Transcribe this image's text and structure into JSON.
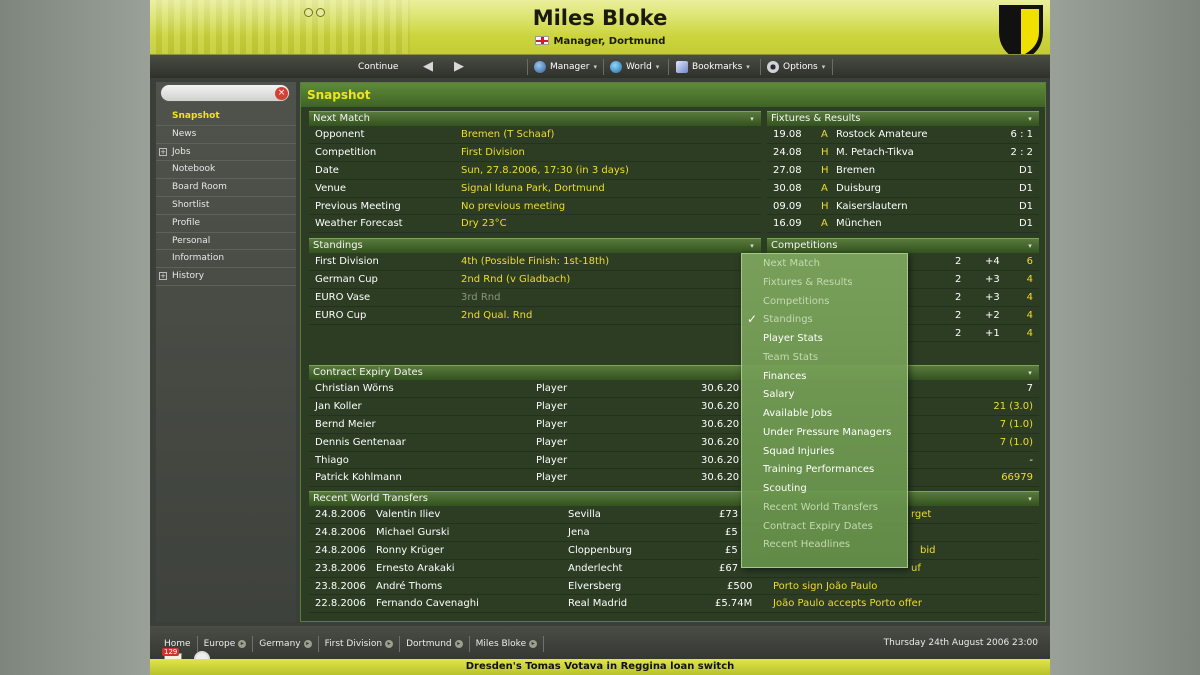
{
  "header": {
    "manager_name": "Miles Bloke",
    "manager_role": "Manager, Dortmund",
    "nav": {
      "continue": "Continue",
      "manager": "Manager",
      "world": "World",
      "bookmarks": "Bookmarks",
      "options": "Options"
    },
    "colors": {
      "accent": "#d8e24a",
      "highlight": "#f2e41c"
    }
  },
  "sidebar": {
    "search_value": "",
    "items": [
      {
        "label": "Snapshot",
        "active": true,
        "expandable": false
      },
      {
        "label": "News",
        "active": false,
        "expandable": false
      },
      {
        "label": "Jobs",
        "active": false,
        "expandable": true
      },
      {
        "label": "Notebook",
        "active": false,
        "expandable": false
      },
      {
        "label": "Board Room",
        "active": false,
        "expandable": false
      },
      {
        "label": "Shortlist",
        "active": false,
        "expandable": false
      },
      {
        "label": "Profile",
        "active": false,
        "expandable": false
      },
      {
        "label": "Personal",
        "active": false,
        "expandable": false
      },
      {
        "label": "Information",
        "active": false,
        "expandable": false
      },
      {
        "label": "History",
        "active": false,
        "expandable": true
      }
    ]
  },
  "main": {
    "title": "Snapshot",
    "next_match": {
      "title": "Next Match",
      "rows": [
        {
          "label": "Opponent",
          "value": "Bremen (T Schaaf)"
        },
        {
          "label": "Competition",
          "value": "First Division"
        },
        {
          "label": "Date",
          "value": "Sun, 27.8.2006, 17:30 (in 3 days)"
        },
        {
          "label": "Venue",
          "value": "Signal Iduna Park, Dortmund"
        },
        {
          "label": "Previous Meeting",
          "value": "No previous meeting"
        },
        {
          "label": "Weather Forecast",
          "value": "Dry 23°C"
        }
      ]
    },
    "fixtures": {
      "title": "Fixtures & Results",
      "rows": [
        {
          "date": "19.08",
          "ha": "A",
          "team": "Rostock Amateure",
          "result": "6 : 1"
        },
        {
          "date": "24.08",
          "ha": "H",
          "team": "M. Petach-Tikva",
          "result": "2 : 2"
        },
        {
          "date": "27.08",
          "ha": "H",
          "team": "Bremen",
          "result": "D1"
        },
        {
          "date": "30.08",
          "ha": "A",
          "team": "Duisburg",
          "result": "D1"
        },
        {
          "date": "09.09",
          "ha": "H",
          "team": "Kaiserslautern",
          "result": "D1"
        },
        {
          "date": "16.09",
          "ha": "A",
          "team": "München",
          "result": "D1"
        }
      ]
    },
    "standings": {
      "title": "Standings",
      "rows": [
        {
          "comp": "First Division",
          "status": "4th (Possible Finish: 1st-18th)",
          "dim": false
        },
        {
          "comp": "German Cup",
          "status": "2nd Rnd (v Gladbach)",
          "dim": false
        },
        {
          "comp": "EURO Vase",
          "status": "3rd Rnd",
          "dim": true
        },
        {
          "comp": "EURO Cup",
          "status": "2nd Qual. Rnd",
          "dim": false
        }
      ]
    },
    "competitions": {
      "title": "Competitions",
      "rows": [
        {
          "p": "2",
          "gd": "+4",
          "pts": "6"
        },
        {
          "p": "2",
          "gd": "+3",
          "pts": "4"
        },
        {
          "p": "2",
          "gd": "+3",
          "pts": "4"
        },
        {
          "p": "2",
          "gd": "+2",
          "pts": "4"
        },
        {
          "p": "2",
          "gd": "+1",
          "pts": "4"
        }
      ]
    },
    "contracts": {
      "title": "Contract Expiry Dates",
      "rows": [
        {
          "name": "Christian Wörns",
          "type": "Player",
          "date": "30.6.20",
          "right": "7"
        },
        {
          "name": "Jan Koller",
          "type": "Player",
          "date": "30.6.20",
          "right": "21 (3.0)"
        },
        {
          "name": "Bernd Meier",
          "type": "Player",
          "date": "30.6.20",
          "right": "7 (1.0)"
        },
        {
          "name": "Dennis Gentenaar",
          "type": "Player",
          "date": "30.6.20",
          "right": "7 (1.0)"
        },
        {
          "name": "Thiago",
          "type": "Player",
          "date": "30.6.20",
          "right": "-"
        },
        {
          "name": "Patrick Kohlmann",
          "type": "Player",
          "date": "30.6.20",
          "right": "66979"
        }
      ]
    },
    "transfers": {
      "title": "Recent World Transfers",
      "rows": [
        {
          "date": "24.8.2006",
          "player": "Valentin Iliev",
          "club": "Sevilla",
          "fee": "£73",
          "headline": "rget"
        },
        {
          "date": "24.8.2006",
          "player": "Michael Gurski",
          "club": "Jena",
          "fee": "£5",
          "headline": ""
        },
        {
          "date": "24.8.2006",
          "player": "Ronny Krüger",
          "club": "Cloppenburg",
          "fee": "£5",
          "headline": "bid"
        },
        {
          "date": "23.8.2006",
          "player": "Ernesto Arakaki",
          "club": "Anderlecht",
          "fee": "£67",
          "headline": "uf"
        },
        {
          "date": "23.8.2006",
          "player": "André Thoms",
          "club": "Elversberg",
          "fee": "£500",
          "headline": "Porto sign João Paulo"
        },
        {
          "date": "22.8.2006",
          "player": "Fernando Cavenaghi",
          "club": "Real Madrid",
          "fee": "£5.74M",
          "headline": "João Paulo accepts Porto offer"
        }
      ]
    }
  },
  "dropdown_menu": {
    "items": [
      {
        "label": "Next Match",
        "disabled": true,
        "checked": false
      },
      {
        "label": "Fixtures & Results",
        "disabled": true,
        "checked": false
      },
      {
        "label": "Competitions",
        "disabled": true,
        "checked": false
      },
      {
        "label": "Standings",
        "disabled": true,
        "checked": true
      },
      {
        "label": "Player Stats",
        "disabled": false,
        "checked": false
      },
      {
        "label": "Team Stats",
        "disabled": true,
        "checked": false
      },
      {
        "label": "Finances",
        "disabled": false,
        "checked": false
      },
      {
        "label": "Salary",
        "disabled": false,
        "checked": false
      },
      {
        "label": "Available Jobs",
        "disabled": false,
        "checked": false
      },
      {
        "label": "Under Pressure Managers",
        "disabled": false,
        "checked": false
      },
      {
        "label": "Squad Injuries",
        "disabled": false,
        "checked": false
      },
      {
        "label": "Training Performances",
        "disabled": false,
        "checked": false
      },
      {
        "label": "Scouting",
        "disabled": false,
        "checked": false
      },
      {
        "label": "Recent World Transfers",
        "disabled": true,
        "checked": false
      },
      {
        "label": "Contract Expiry Dates",
        "disabled": true,
        "checked": false
      },
      {
        "label": "Recent Headlines",
        "disabled": true,
        "checked": false
      }
    ]
  },
  "footer": {
    "breadcrumbs": [
      "Home",
      "Europe",
      "Germany",
      "First Division",
      "Dortmund",
      "Miles Bloke"
    ],
    "date": "Thursday 24th August 2006 23:00",
    "mail_count": "129",
    "ticker": "Dresden's Tomas Votava in Reggina loan switch"
  }
}
